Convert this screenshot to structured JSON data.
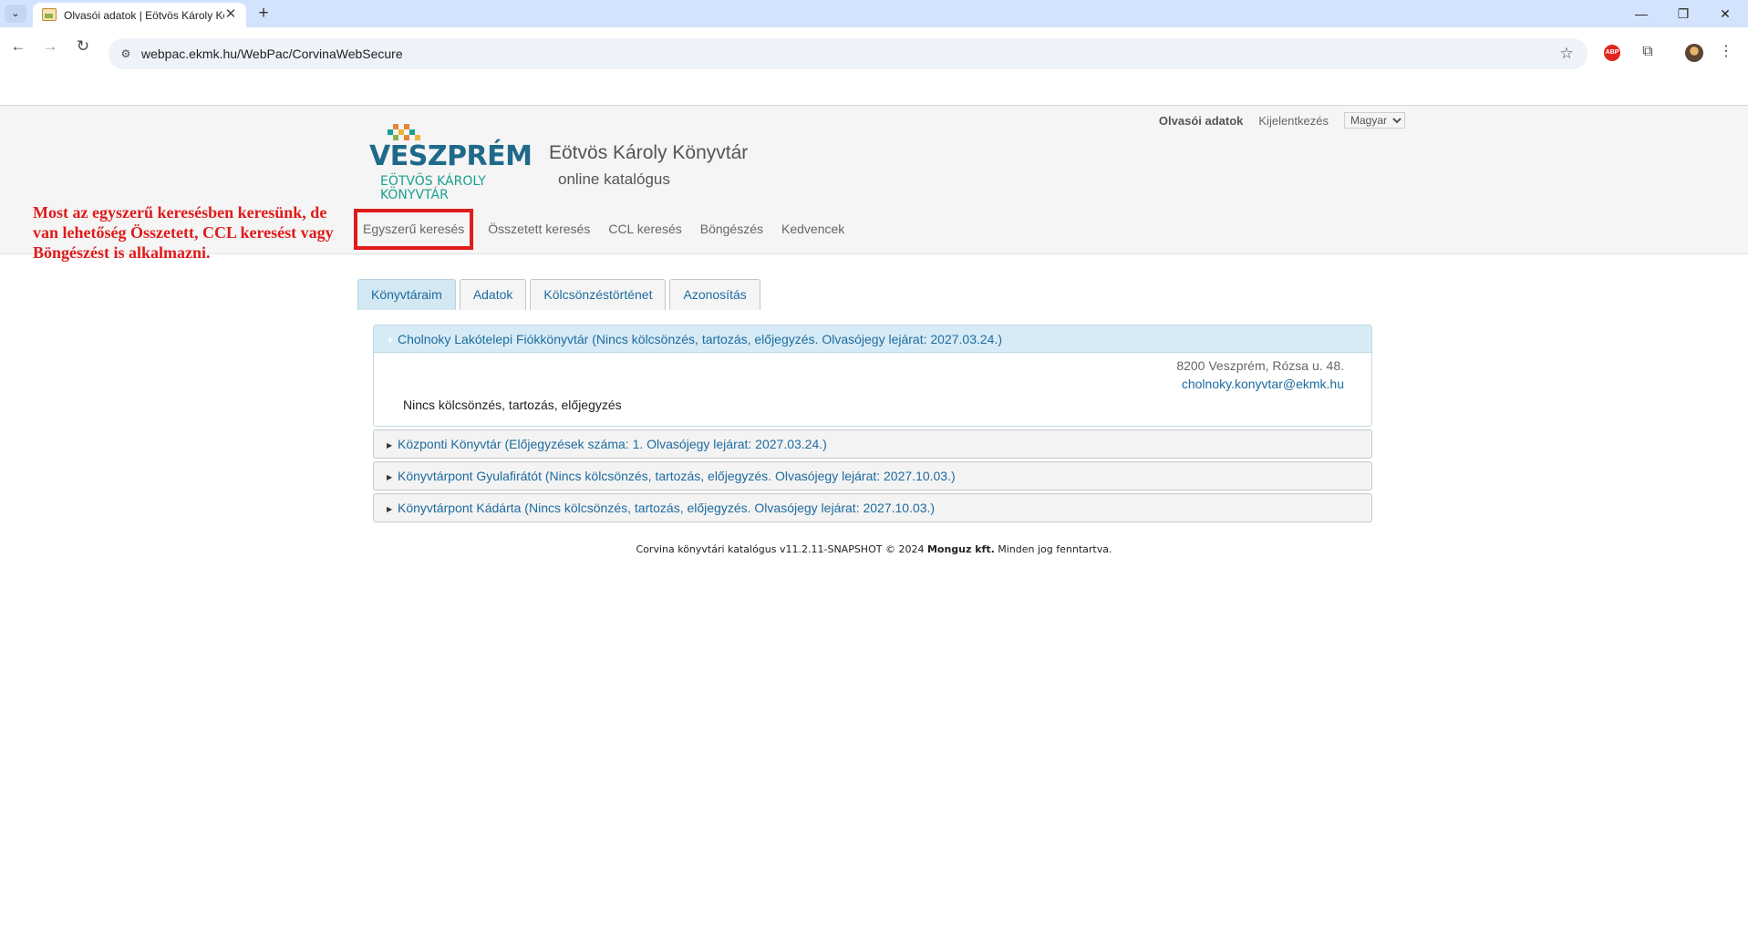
{
  "browser": {
    "tab_title": "Olvasói adatok | Eötvös Károly Könyvtár",
    "url": "webpac.ekmk.hu/WebPac/CorvinaWebSecure",
    "new_tab_symbol": "+",
    "close_symbol": "✕",
    "ext_abp_label": "ABP"
  },
  "header": {
    "user_link": "Olvasói adatok",
    "logout_link": "Kijelentkezés",
    "language": {
      "selected": "Magyar",
      "options": [
        "Magyar"
      ]
    },
    "logo": {
      "main": "VESZPRÉM",
      "line1": "EÖTVÖS KÁROLY",
      "line2": "KÖNYVTÁR"
    },
    "title": "Eötvös Károly Könyvtár",
    "subtitle": "online katalógus"
  },
  "annotation": "Most az egyszerű keresésben keresünk, de van lehetőség Összetett, CCL keresést vagy Böngészést is alkalmazni.",
  "nav": [
    {
      "label": "Egyszerű keresés",
      "active": true
    },
    {
      "label": "Összetett keresés"
    },
    {
      "label": "CCL keresés"
    },
    {
      "label": "Böngészés"
    },
    {
      "label": "Kedvencek"
    }
  ],
  "tabs": [
    {
      "label": "Könyvtáraim",
      "selected": true
    },
    {
      "label": "Adatok"
    },
    {
      "label": "Kölcsönzéstörténet"
    },
    {
      "label": "Azonosítás"
    }
  ],
  "libraries": [
    {
      "title": "Cholnoky Lakótelepi Fiókkönyvtár (Nincs kölcsönzés, tartozás, előjegyzés. Olvasójegy lejárat: 2027.03.24.)",
      "open": true,
      "address": "8200 Veszprém, Rózsa u. 48.",
      "email": "cholnoky.konyvtar@ekmk.hu",
      "status": "Nincs kölcsönzés, tartozás, előjegyzés"
    },
    {
      "title": "Központi Könyvtár (Előjegyzések száma: 1. Olvasójegy lejárat: 2027.03.24.)"
    },
    {
      "title": "Könyvtárpont Gyulafirátót (Nincs kölcsönzés, tartozás, előjegyzés. Olvasójegy lejárat: 2027.10.03.)"
    },
    {
      "title": "Könyvtárpont Kádárta (Nincs kölcsönzés, tartozás, előjegyzés. Olvasójegy lejárat: 2027.10.03.)"
    }
  ],
  "footer": {
    "prefix": "Corvina könyvtári katalógus v11.2.11-SNAPSHOT © 2024 ",
    "company": "Monguz kft.",
    "suffix": " Minden jog fenntartva."
  },
  "colors": {
    "accent_link": "#1e6b9f",
    "annotation_red": "#e01b1b",
    "chrome_tabstrip": "#d3e3fd"
  }
}
